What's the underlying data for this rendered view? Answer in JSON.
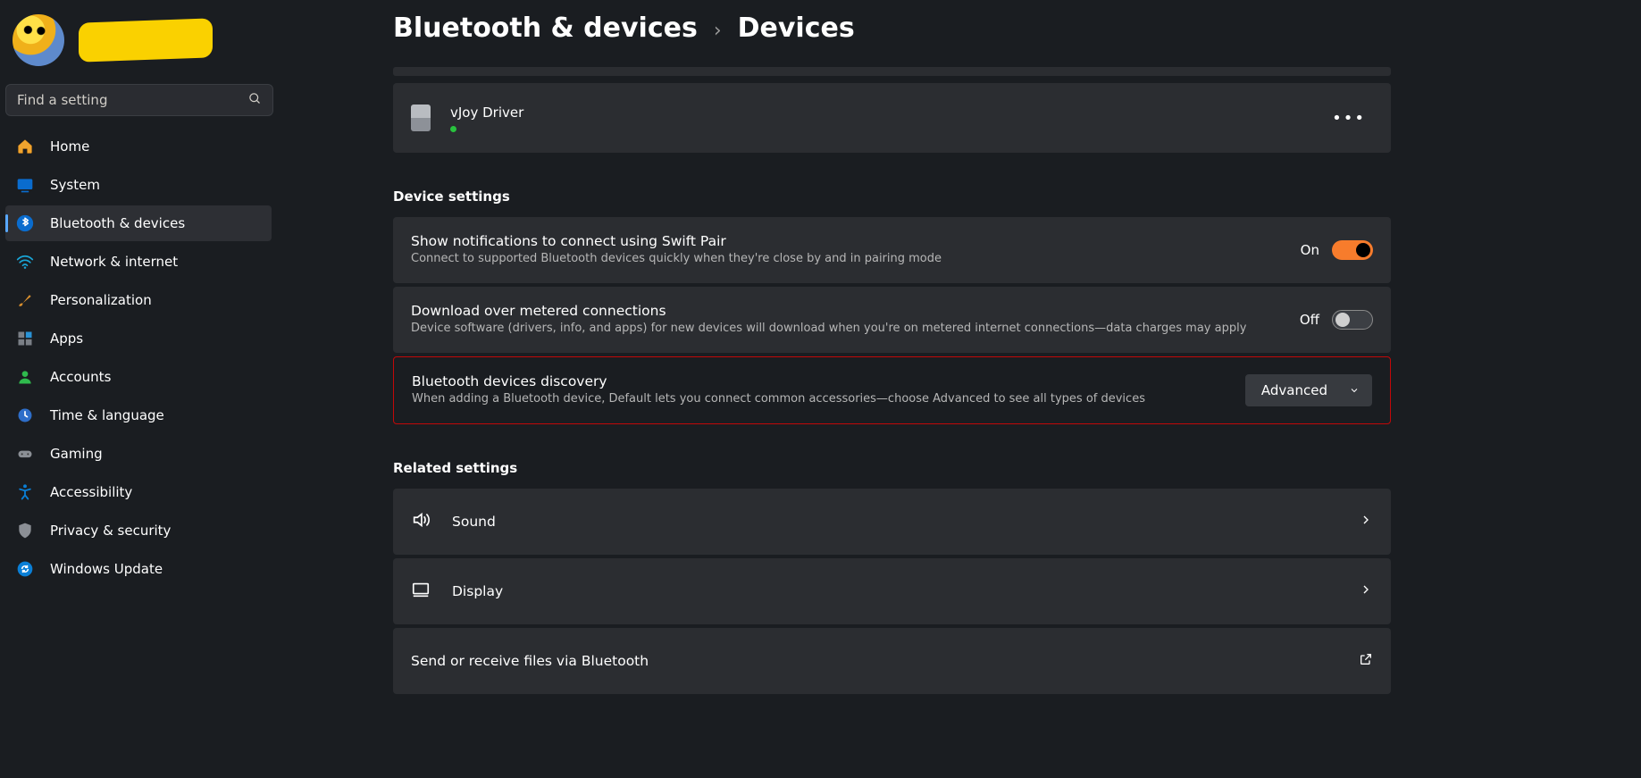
{
  "search": {
    "placeholder": "Find a setting"
  },
  "nav": {
    "items": [
      {
        "label": "Home"
      },
      {
        "label": "System"
      },
      {
        "label": "Bluetooth & devices"
      },
      {
        "label": "Network & internet"
      },
      {
        "label": "Personalization"
      },
      {
        "label": "Apps"
      },
      {
        "label": "Accounts"
      },
      {
        "label": "Time & language"
      },
      {
        "label": "Gaming"
      },
      {
        "label": "Accessibility"
      },
      {
        "label": "Privacy & security"
      },
      {
        "label": "Windows Update"
      }
    ]
  },
  "breadcrumb": {
    "parent": "Bluetooth & devices",
    "sep": "›",
    "current": "Devices"
  },
  "device": {
    "name": "vJoy Driver",
    "more": "•••"
  },
  "sections": {
    "device_settings": "Device settings",
    "related_settings": "Related settings"
  },
  "settings": {
    "swift_pair": {
      "title": "Show notifications to connect using Swift Pair",
      "desc": "Connect to supported Bluetooth devices quickly when they're close by and in pairing mode",
      "state_label": "On"
    },
    "metered": {
      "title": "Download over metered connections",
      "desc": "Device software (drivers, info, and apps) for new devices will download when you're on metered internet connections—data charges may apply",
      "state_label": "Off"
    },
    "discovery": {
      "title": "Bluetooth devices discovery",
      "desc": "When adding a Bluetooth device, Default lets you connect common accessories—choose Advanced to see all types of devices",
      "value": "Advanced"
    }
  },
  "related": {
    "sound": "Sound",
    "display": "Display",
    "bt_files": "Send or receive files via Bluetooth"
  }
}
